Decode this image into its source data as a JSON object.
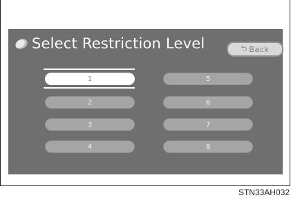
{
  "screen": {
    "title": "Select Restriction Level",
    "back_label": "Back",
    "levels": [
      {
        "label": "1",
        "selected": true
      },
      {
        "label": "2",
        "selected": false
      },
      {
        "label": "3",
        "selected": false
      },
      {
        "label": "4",
        "selected": false
      },
      {
        "label": "5",
        "selected": false
      },
      {
        "label": "6",
        "selected": false
      },
      {
        "label": "7",
        "selected": false
      },
      {
        "label": "8",
        "selected": false
      }
    ]
  },
  "caption": "STN33AH032",
  "icons": {
    "title_icon": "disc-icon",
    "back_icon": "return-arrow-icon"
  }
}
